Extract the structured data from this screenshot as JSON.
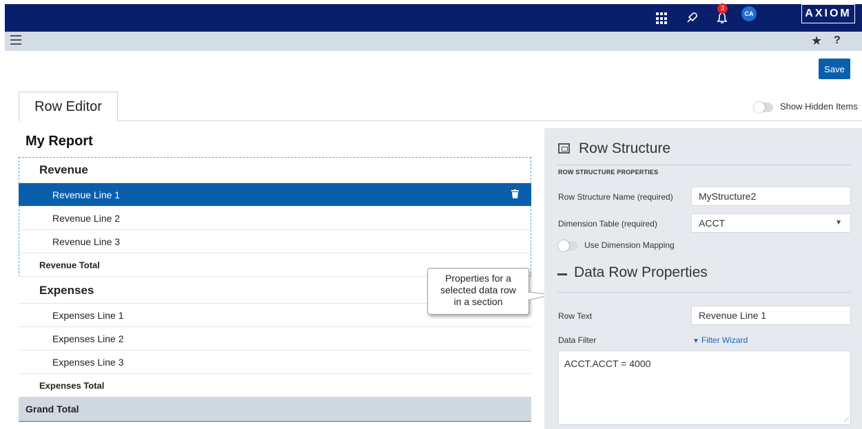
{
  "topbar": {
    "notification_count": "3",
    "avatar_initials": "CA",
    "logo_text": "AXIOM",
    "icons": [
      "apps-grid-icon",
      "rocket-icon",
      "bell-icon"
    ]
  },
  "subbar": {
    "icons": [
      "menu-icon",
      "star-icon",
      "help-icon"
    ],
    "help_glyph": "?"
  },
  "toolbar": {
    "save_label": "Save"
  },
  "tabs": [
    {
      "label": "Row Editor"
    }
  ],
  "show_hidden": {
    "label": "Show Hidden Items"
  },
  "report": {
    "title": "My Report",
    "rows": [
      {
        "label": "Revenue",
        "kind": "header"
      },
      {
        "label": "Revenue Line 1",
        "kind": "line",
        "selected": true
      },
      {
        "label": "Revenue Line 2",
        "kind": "line"
      },
      {
        "label": "Revenue Line 3",
        "kind": "line"
      },
      {
        "label": "Revenue Total",
        "kind": "total"
      },
      {
        "label": "Expenses",
        "kind": "header"
      },
      {
        "label": "Expenses Line 1",
        "kind": "line"
      },
      {
        "label": "Expenses Line 2",
        "kind": "line"
      },
      {
        "label": "Expenses Line 3",
        "kind": "line"
      },
      {
        "label": "Expenses Total",
        "kind": "total"
      },
      {
        "label": "Grand Total",
        "kind": "grand"
      }
    ]
  },
  "callout": {
    "line1": "Properties for a",
    "line2": "selected data row",
    "line3": "in a section"
  },
  "panel": {
    "title": "Row Structure",
    "subtitle": "ROW STRUCTURE PROPERTIES",
    "name_label": "Row Structure Name (required)",
    "name_value": "MyStructure2",
    "dim_label": "Dimension Table (required)",
    "dim_value": "ACCT",
    "mapping_label": "Use Dimension Mapping",
    "section_title": "Data Row Properties",
    "row_text_label": "Row Text",
    "row_text_value": "Revenue Line 1",
    "filter_label": "Data Filter",
    "filter_link": "Filter Wizard",
    "filter_value": "ACCT.ACCT = 4000"
  },
  "colors": {
    "topbar": "#0a1f6b",
    "accent": "#0a5fad",
    "badge": "#e0242b",
    "panel_bg": "#e6eaee"
  }
}
